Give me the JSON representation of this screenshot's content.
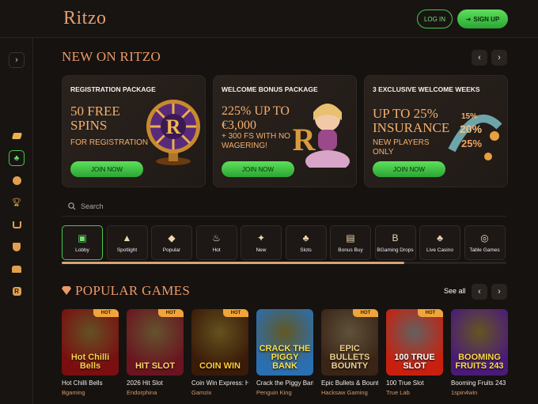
{
  "header": {
    "logo": "Ritzo",
    "login_label": "LOG IN",
    "signup_label": "SIGN UP"
  },
  "sidebar": {
    "toggle_icon": "chevron-right-icon",
    "items": [
      {
        "icon": "coin-icon"
      },
      {
        "icon": "club-icon",
        "active": true
      },
      {
        "icon": "compass-icon"
      },
      {
        "icon": "trophy-icon"
      },
      {
        "icon": "cart-icon"
      },
      {
        "icon": "shield-icon"
      },
      {
        "icon": "chest-icon"
      },
      {
        "icon": "ritzo-r-icon"
      }
    ]
  },
  "new_section": {
    "title": "NEW ON RITZO",
    "promos": [
      {
        "title": "REGISTRATION PACKAGE",
        "big": "50 FREE SPINS",
        "small": "FOR REGISTRATION",
        "button": "JOIN NOW"
      },
      {
        "title": "WELCOME BONUS PACKAGE",
        "big": "225% UP TO €3,000",
        "small": "+ 300 FS WITH NO WAGERING!",
        "button": "JOIN NOW"
      },
      {
        "title": "3 EXCLUSIVE WELCOME WEEKS",
        "big": "UP TO 25% INSURANCE",
        "small": "NEW PLAYERS ONLY",
        "button": "JOIN NOW"
      }
    ]
  },
  "search": {
    "placeholder": "Search"
  },
  "categories": {
    "progress": 0.77,
    "items": [
      {
        "label": "Lobby",
        "icon": "lobby-icon",
        "glyph": "▣"
      },
      {
        "label": "Spotlight",
        "icon": "spotlight-icon",
        "glyph": "▲"
      },
      {
        "label": "Popular",
        "icon": "diamond-icon",
        "glyph": "◆"
      },
      {
        "label": "Hot",
        "icon": "flame-icon",
        "glyph": "♨"
      },
      {
        "label": "New",
        "icon": "new-icon",
        "glyph": "✦"
      },
      {
        "label": "Slots",
        "icon": "cherry-icon",
        "glyph": "♣"
      },
      {
        "label": "Bonus Buy",
        "icon": "gift-icon",
        "glyph": "▤"
      },
      {
        "label": "BGaming Drops",
        "icon": "bgaming-icon",
        "glyph": "B"
      },
      {
        "label": "Live Casino",
        "icon": "club-icon",
        "glyph": "♣"
      },
      {
        "label": "Table Games",
        "icon": "chips-icon",
        "glyph": "◎"
      }
    ]
  },
  "popular": {
    "title": "POPULAR GAMES",
    "see_all": "See all",
    "games": [
      {
        "name": "Hot Chilli Bells",
        "provider": "Bgaming",
        "badge": "HOT",
        "art": "Hot Chilli Bells",
        "bg": "#7a0e10",
        "fg": "#ffd14a"
      },
      {
        "name": "2026 Hit Slot",
        "provider": "Endorphina",
        "badge": "HOT",
        "art": "HIT SLOT",
        "bg": "#6a1420",
        "fg": "#ffd66a"
      },
      {
        "name": "Coin Win Express: Hold t…",
        "provider": "Gamzix",
        "badge": "HOT",
        "art": "COIN WIN",
        "bg": "#3a1a08",
        "fg": "#ffcf3a"
      },
      {
        "name": "Crack the Piggy Bank",
        "provider": "Penguin King",
        "badge": "",
        "art": "CRACK THE PIGGY BANK",
        "bg": "#2a6fb0",
        "fg": "#ffe24a"
      },
      {
        "name": "Epic Bullets & Bounty",
        "provider": "Hacksaw Gaming",
        "badge": "HOT",
        "art": "EPIC BULLETS BOUNTY",
        "bg": "#3a2416",
        "fg": "#f0d090"
      },
      {
        "name": "100 True Slot",
        "provider": "True Lab",
        "badge": "HOT",
        "art": "100 TRUE SLOT",
        "bg": "#c8200e",
        "fg": "#ffffff"
      },
      {
        "name": "Booming Fruits 243",
        "provider": "1spin4win",
        "badge": "",
        "art": "BOOMING FRUITS 243",
        "bg": "#4a1a7a",
        "fg": "#ffdd44"
      }
    ]
  },
  "colors": {
    "accent_green": "#46c94c",
    "accent_gold": "#ec9a6a",
    "hot_badge": "#f0a53a"
  }
}
